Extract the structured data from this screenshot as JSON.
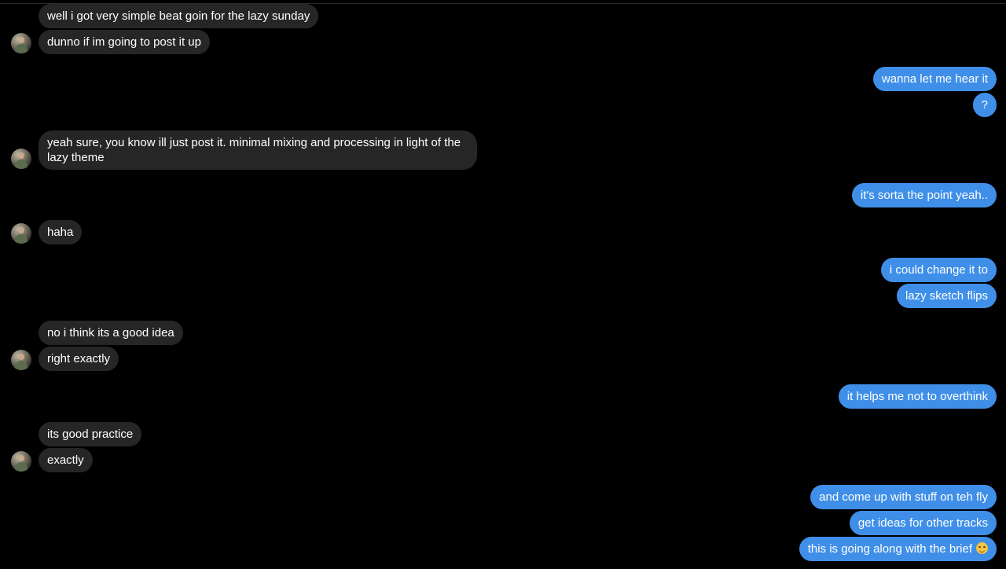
{
  "colors": {
    "background": "#000000",
    "incoming_bubble": "#262626",
    "outgoing_bubble": "#3f8fe8",
    "text": "#ffffff"
  },
  "avatar_icon": "contact-avatar",
  "messages": [
    {
      "dir": "in",
      "text": "well i got very simple beat goin for the lazy sunday"
    },
    {
      "dir": "in",
      "text": "dunno if im going to post it up"
    },
    {
      "dir": "out",
      "text": "wanna let me hear it"
    },
    {
      "dir": "out",
      "text": "?"
    },
    {
      "dir": "in",
      "text": "yeah sure, you know ill just post it. minimal mixing and processing in light of the lazy theme"
    },
    {
      "dir": "out",
      "text": "it's sorta the point yeah.."
    },
    {
      "dir": "in",
      "text": "haha"
    },
    {
      "dir": "out",
      "text": "i could change it to"
    },
    {
      "dir": "out",
      "text": "lazy sketch flips"
    },
    {
      "dir": "in",
      "text": "no i think its a good idea"
    },
    {
      "dir": "in",
      "text": "right exactly"
    },
    {
      "dir": "out",
      "text": "it helps me not to overthink"
    },
    {
      "dir": "in",
      "text": "its good practice"
    },
    {
      "dir": "in",
      "text": "exactly"
    },
    {
      "dir": "out",
      "text": "and come up with stuff on teh fly"
    },
    {
      "dir": "out",
      "text": "get ideas for other tracks"
    },
    {
      "dir": "out",
      "text": "this is going along with the brief",
      "emoji": "smirk-emoji"
    }
  ]
}
